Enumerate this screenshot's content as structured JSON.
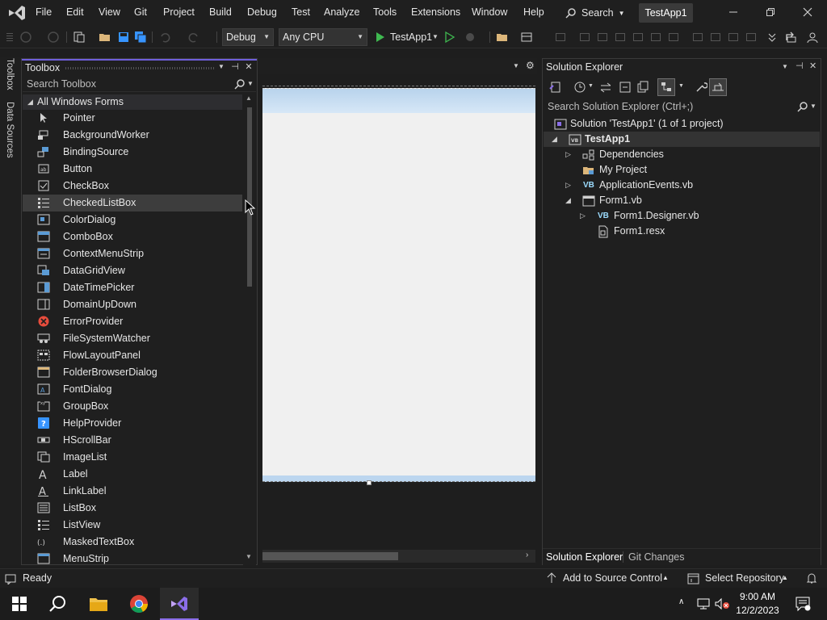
{
  "menubar": {
    "items": [
      "File",
      "Edit",
      "View",
      "Git",
      "Project",
      "Build",
      "Debug",
      "Test",
      "Analyze",
      "Tools",
      "Extensions",
      "Window",
      "Help"
    ],
    "search_label": "Search",
    "project_badge": "TestApp1"
  },
  "toolbar": {
    "configuration": "Debug",
    "platform": "Any CPU",
    "run_target": "TestApp1"
  },
  "left_strip": {
    "tabs": [
      "Toolbox",
      "Data Sources"
    ]
  },
  "toolbox": {
    "title": "Toolbox",
    "search_placeholder": "Search Toolbox",
    "group": "All Windows Forms",
    "items": [
      "Pointer",
      "BackgroundWorker",
      "BindingSource",
      "Button",
      "CheckBox",
      "CheckedListBox",
      "ColorDialog",
      "ComboBox",
      "ContextMenuStrip",
      "DataGridView",
      "DateTimePicker",
      "DomainUpDown",
      "ErrorProvider",
      "FileSystemWatcher",
      "FlowLayoutPanel",
      "FolderBrowserDialog",
      "FontDialog",
      "GroupBox",
      "HelpProvider",
      "HScrollBar",
      "ImageList",
      "Label",
      "LinkLabel",
      "ListBox",
      "ListView",
      "MaskedTextBox",
      "MenuStrip"
    ],
    "selected_item": "CheckedListBox"
  },
  "solution_explorer": {
    "title": "Solution Explorer",
    "search_placeholder": "Search Solution Explorer (Ctrl+;)",
    "solution_label": "Solution 'TestApp1' (1 of 1 project)",
    "project": "TestApp1",
    "nodes": {
      "dependencies": "Dependencies",
      "my_project": "My Project",
      "application_events": "ApplicationEvents.vb",
      "form1": "Form1.vb",
      "form1_designer": "Form1.Designer.vb",
      "form1_resx": "Form1.resx"
    },
    "vb_badge": "VB",
    "tabs": [
      "Solution Explorer",
      "Git Changes"
    ]
  },
  "statusbar": {
    "status": "Ready",
    "source_control": "Add to Source Control",
    "repository": "Select Repository"
  },
  "taskbar": {
    "time": "9:00 AM",
    "date": "12/2/2023"
  },
  "colors": {
    "accent": "#6f5fdb",
    "vs_purple": "#8b6ee8",
    "run_green": "#3fb950",
    "error_red": "#e74c3c",
    "background": "#1f1f1f"
  }
}
